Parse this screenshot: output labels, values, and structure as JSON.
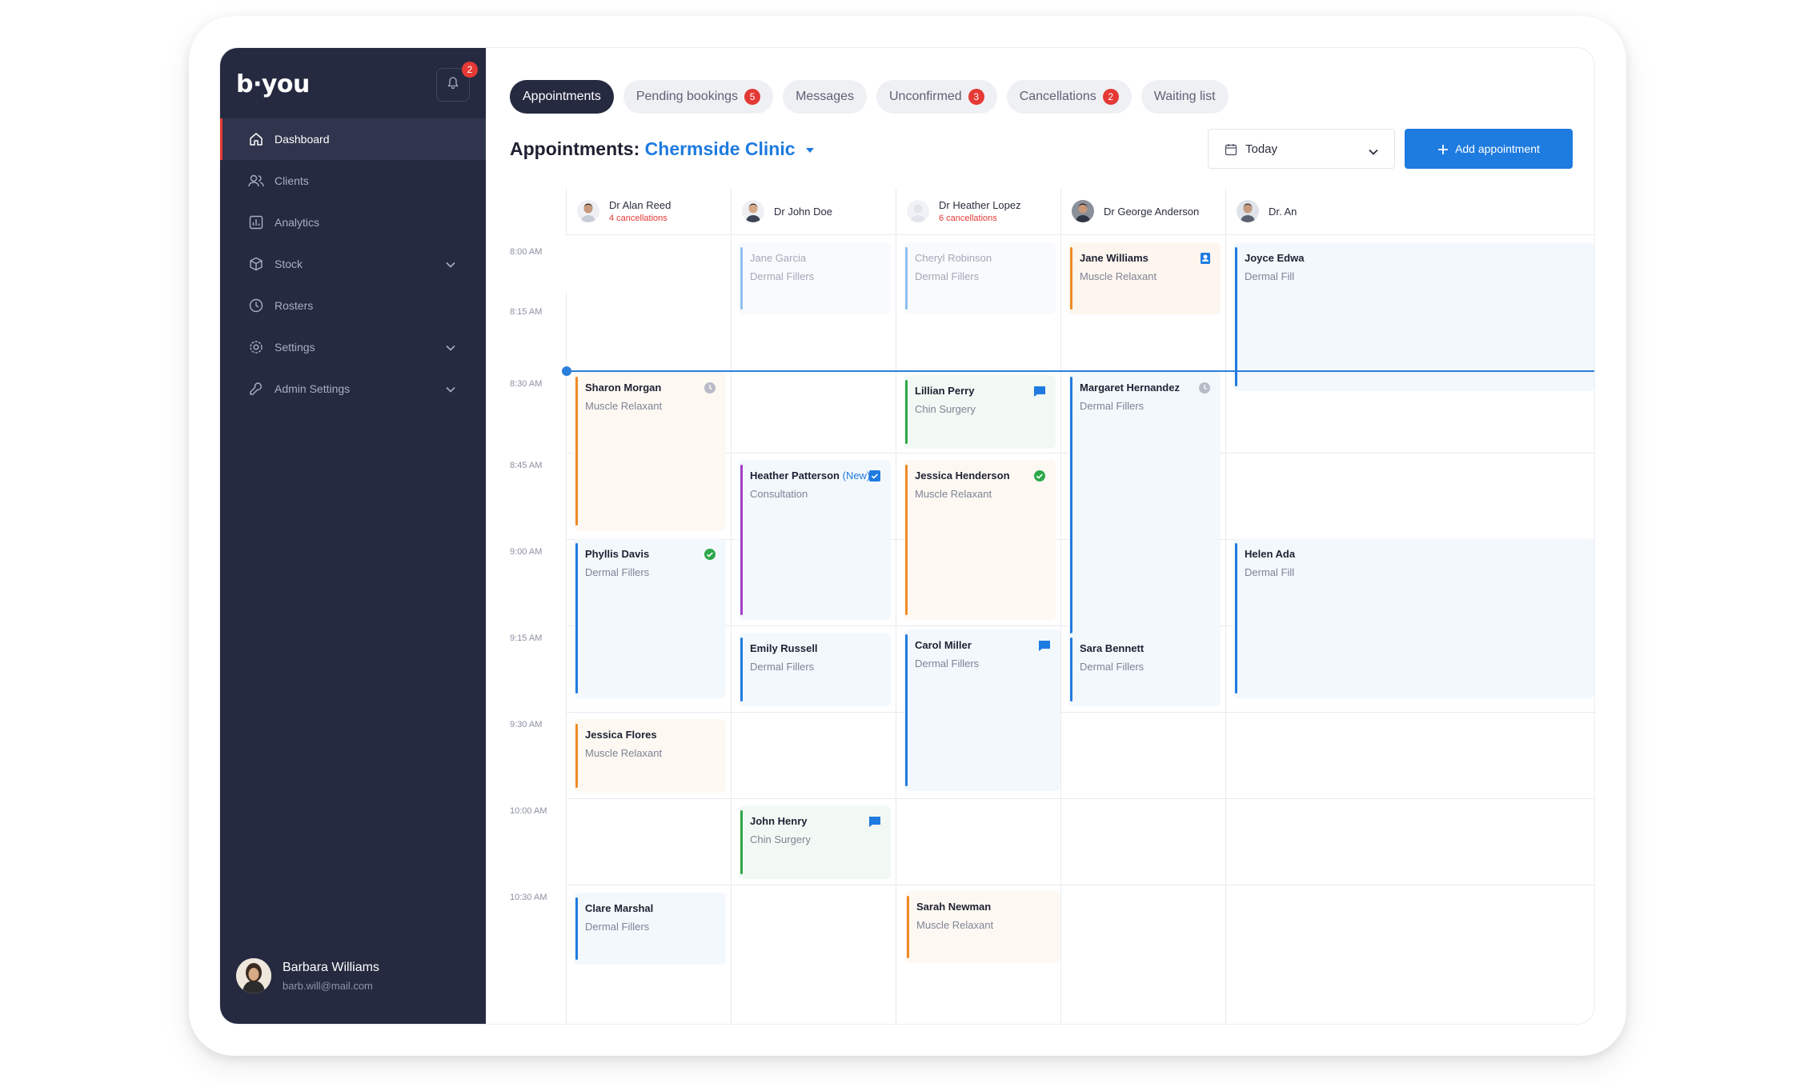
{
  "app": {
    "logo": "b·you"
  },
  "notifications": {
    "count": "2"
  },
  "sidebar": {
    "items": [
      {
        "label": "Dashboard",
        "icon": "home-icon",
        "active": true
      },
      {
        "label": "Clients",
        "icon": "users-icon"
      },
      {
        "label": "Analytics",
        "icon": "chart-icon"
      },
      {
        "label": "Stock",
        "icon": "box-icon",
        "expandable": true
      },
      {
        "label": "Rosters",
        "icon": "clock-icon"
      },
      {
        "label": "Settings",
        "icon": "gear-icon",
        "expandable": true
      },
      {
        "label": "Admin Settings",
        "icon": "wrench-icon",
        "expandable": true
      }
    ],
    "user": {
      "name": "Barbara Williams",
      "email": "barb.will@mail.com"
    }
  },
  "tabs": [
    {
      "label": "Appointments",
      "active": true
    },
    {
      "label": "Pending bookings",
      "badge": "5"
    },
    {
      "label": "Messages"
    },
    {
      "label": "Unconfirmed",
      "badge": "3"
    },
    {
      "label": "Cancellations",
      "badge": "2"
    },
    {
      "label": "Waiting list"
    }
  ],
  "header": {
    "title_prefix": "Appointments:",
    "clinic": "Chermside Clinic",
    "date_value": "Today",
    "add_button": "Add appointment"
  },
  "colors": {
    "accent": "#1e7be0",
    "sidebar": "#262a40",
    "danger": "#e53935",
    "orange": "#f08a24",
    "blue": "#1e7be0",
    "green": "#2ea84a",
    "purple": "#a43fc5"
  },
  "doctors": [
    {
      "name": "Dr Alan Reed",
      "cancellations": "4 cancellations"
    },
    {
      "name": "Dr John Doe",
      "cancellations": ""
    },
    {
      "name": "Dr Heather Lopez",
      "cancellations": "6 cancellations"
    },
    {
      "name": "Dr George Anderson",
      "cancellations": ""
    },
    {
      "name": "Dr. An",
      "cancellations": ""
    }
  ],
  "times": [
    "8:00 AM",
    "8:15 AM",
    "8:30 AM",
    "8:45 AM",
    "9:00 AM",
    "9:15 AM",
    "9:30 AM",
    "10:00 AM",
    "10:30 AM"
  ],
  "appointments": [
    {
      "name": "Sharon Morgan",
      "type": "Muscle Relaxant",
      "color": "orange",
      "status_icon": "clock-icon"
    },
    {
      "name": "Phyllis Davis",
      "type": "Dermal Fillers",
      "color": "blue",
      "status_icon": "check-circle-icon"
    },
    {
      "name": "Jessica Flores",
      "type": "Muscle Relaxant",
      "color": "orange"
    },
    {
      "name": "Clare Marshal",
      "type": "Dermal Fillers",
      "color": "blue"
    },
    {
      "name": "Jane Garcia",
      "type": "Dermal Fillers",
      "color": "blue",
      "faded": true
    },
    {
      "name": "Heather Patterson",
      "new_tag": "(New)",
      "type": "Consultation",
      "color": "purple",
      "status_icon": "check-square-icon"
    },
    {
      "name": "Emily Russell",
      "type": "Dermal Fillers",
      "color": "blue"
    },
    {
      "name": "John Henry",
      "type": "Chin Surgery",
      "color": "green",
      "status_icon": "message-icon"
    },
    {
      "name": "Cheryl Robinson",
      "type": "Dermal Fillers",
      "color": "blue",
      "faded": true
    },
    {
      "name": "Lillian Perry",
      "type": "Chin Surgery",
      "color": "green",
      "status_icon": "message-icon"
    },
    {
      "name": "Jessica Henderson",
      "type": "Muscle Relaxant",
      "color": "orange",
      "status_icon": "check-circle-icon"
    },
    {
      "name": "Carol Miller",
      "type": "Dermal Fillers",
      "color": "blue",
      "status_icon": "message-icon"
    },
    {
      "name": "Sarah Newman",
      "type": "Muscle Relaxant",
      "color": "orange"
    },
    {
      "name": "Jane Williams",
      "type": "Muscle Relaxant",
      "color": "orange",
      "status_icon": "user-badge-icon"
    },
    {
      "name": "Margaret Hernandez",
      "type": "Dermal Fillers",
      "color": "blue",
      "status_icon": "clock-icon"
    },
    {
      "name": "Sara Bennett",
      "type": "Dermal Fillers",
      "color": "blue"
    },
    {
      "name": "Joyce Edwa",
      "type": "Dermal Fill",
      "color": "blue"
    },
    {
      "name": "Helen Ada",
      "type": "Dermal Fill",
      "color": "blue"
    }
  ]
}
